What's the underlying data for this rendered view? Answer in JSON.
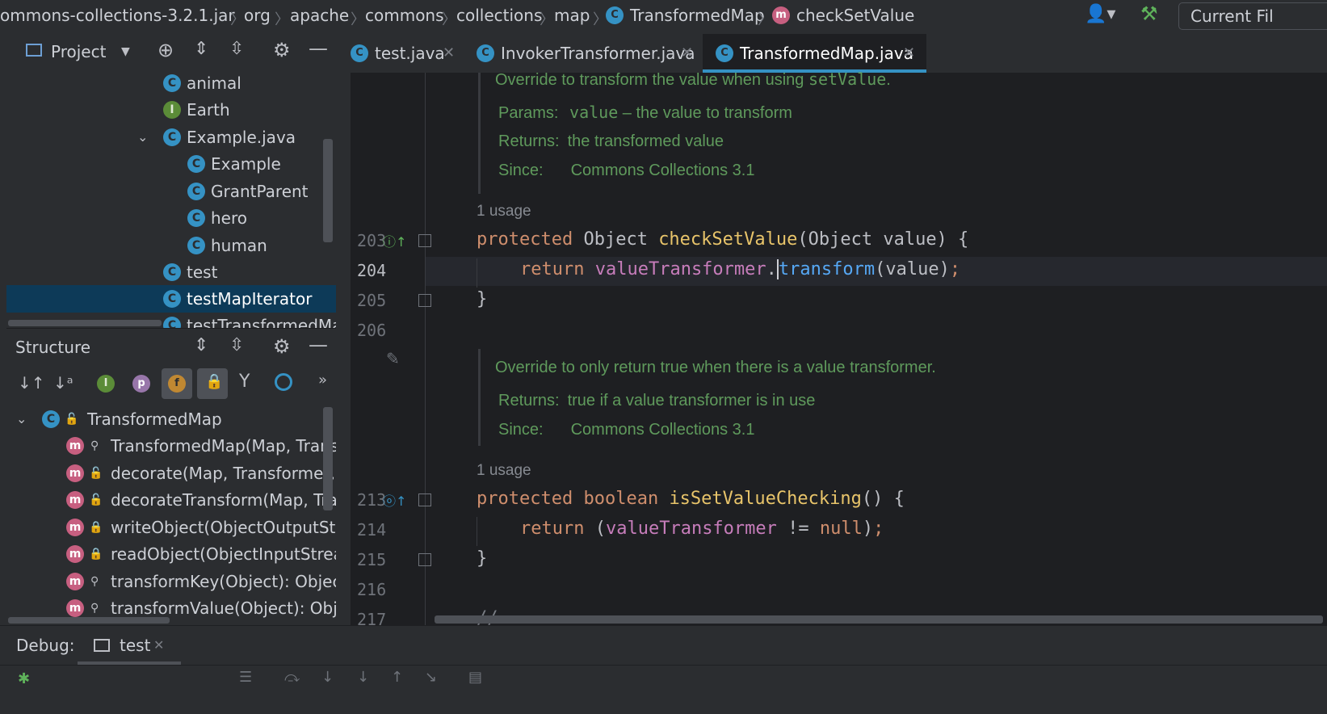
{
  "breadcrumb": {
    "items": [
      "ommons-collections-3.2.1.jar",
      "org",
      "apache",
      "commons",
      "collections",
      "map",
      "TransformedMap",
      "checkSetValue"
    ],
    "current_file_label": "Current Fil"
  },
  "project_toolbar": {
    "label": "Project"
  },
  "project_tree": [
    {
      "label": "animal",
      "icon": "class-icon"
    },
    {
      "label": "Earth",
      "icon": "interface-icon"
    },
    {
      "label": "Example.java",
      "icon": "class-icon"
    },
    {
      "label": "Example",
      "icon": "class-icon"
    },
    {
      "label": "GrantParent",
      "icon": "class-icon"
    },
    {
      "label": "hero",
      "icon": "class-icon"
    },
    {
      "label": "human",
      "icon": "class-icon"
    },
    {
      "label": "test",
      "icon": "class-icon"
    },
    {
      "label": "testMapIterator",
      "icon": "class-icon"
    },
    {
      "label": "testTransformedMap",
      "icon": "class-icon"
    }
  ],
  "structure": {
    "title": "Structure",
    "root": "TransformedMap",
    "items": [
      "TransformedMap(Map, Transfor",
      "decorate(Map, Transformer, Tra",
      "decorateTransform(Map, Transf",
      "writeObject(ObjectOutputStrear",
      "readObject(ObjectInputStream)",
      "transformKey(Object): Object",
      "transformValue(Object): Object"
    ]
  },
  "tabs": [
    {
      "label": "test.java",
      "active": false
    },
    {
      "label": "InvokerTransformer.java",
      "active": false
    },
    {
      "label": "TransformedMap.java",
      "active": true
    }
  ],
  "editor": {
    "doc1": {
      "summary_prefix": "Override to transform the value when using ",
      "summary_code": "setValue",
      "summary_suffix": ".",
      "params_label": "Params:",
      "params_code": "value",
      "params_text": " – the value to transform",
      "returns_label": "Returns:",
      "returns_text": "the transformed value",
      "since_label": "Since:",
      "since_text": "Commons Collections 3.1"
    },
    "usage1": "1 usage",
    "doc2": {
      "summary": "Override to only return true when there is a value transformer.",
      "returns_label": "Returns:",
      "returns_text": "true if a value transformer is in use",
      "since_label": "Since:",
      "since_text": "Commons Collections 3.1"
    },
    "usage2": "1 usage",
    "line_numbers": [
      "203",
      "204",
      "205",
      "206",
      "213",
      "214",
      "215",
      "216",
      "217"
    ],
    "code": {
      "l203": {
        "kw": "protected",
        "type": " Object ",
        "fn": "checkSetValue",
        "rest": "(Object value) {"
      },
      "l204": {
        "kw": "return",
        "field": "valueTransformer",
        "dot": ".",
        "fn": "transform",
        "rest": "(value)",
        "semi": ";"
      },
      "l205": "}",
      "l213": {
        "kw": "protected",
        "kw2": "boolean",
        "fn": "isSetValueChecking",
        "rest": "() {"
      },
      "l214": {
        "kw": "return",
        "open": " (",
        "field": "valueTransformer",
        "op": " != ",
        "kw2": "null",
        "close": ")",
        "semi": ";"
      },
      "l215": "}",
      "l217": "//-------------------------------------------------------------------------------"
    }
  },
  "debug": {
    "label": "Debug:",
    "tab": "test"
  },
  "colors": {
    "accent": "#3592c4",
    "doc_green": "#5f9a5c",
    "keyword": "#cf8e6d",
    "selected_row": "#0d3a58"
  }
}
